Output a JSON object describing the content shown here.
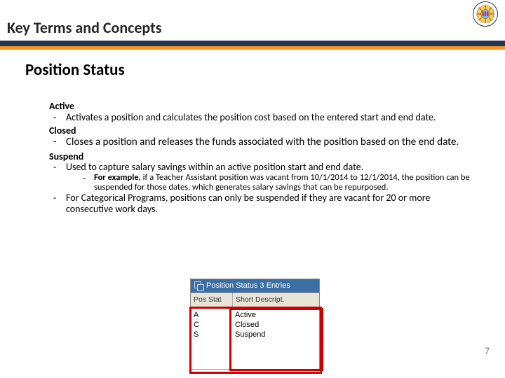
{
  "section_title": "Key Terms and Concepts",
  "heading": "Position Status",
  "terms": {
    "active": {
      "name": "Active",
      "desc": "Activates a position and calculates the position cost based on the entered start and end date."
    },
    "closed": {
      "name": "Closed",
      "desc": "Closes a position and releases the funds associated with the position based on the end date."
    },
    "suspend": {
      "name": "Suspend",
      "b1": "Used to capture salary savings within an active position start and end date.",
      "ex_label": "For example,",
      "ex_rest": " if a Teacher Assistant position was vacant from 10/1/2014 to 12/1/2014, the position can be suspended for those dates, which generates salary savings that can be repurposed.",
      "b2": "For Categorical Programs, positions can only be suspended if they are vacant for 20 or more consecutive work days."
    }
  },
  "screenshot": {
    "title": "Position Status 3 Entries",
    "columns": {
      "c1": "Pos Stat",
      "c2": "Short Descript."
    },
    "rows": [
      {
        "code": "A",
        "label": "Active"
      },
      {
        "code": "C",
        "label": "Closed"
      },
      {
        "code": "S",
        "label": "Suspend"
      }
    ]
  },
  "page_number": "7"
}
